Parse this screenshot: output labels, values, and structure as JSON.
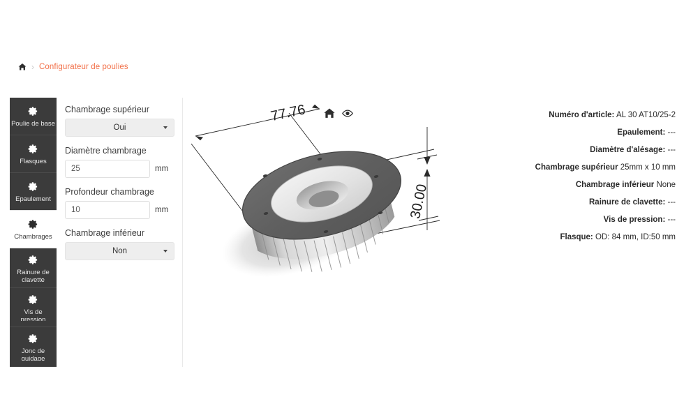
{
  "breadcrumb": {
    "home_icon": "home-icon",
    "separator": "›",
    "link": "Configurateur de poulies"
  },
  "sidebar": {
    "items": [
      {
        "label": "Poulie de base",
        "icon": "gear-icon",
        "active": false
      },
      {
        "label": "Flasques",
        "icon": "gear-icon",
        "active": false
      },
      {
        "label": "Epaulement",
        "icon": "gear-icon",
        "active": false
      },
      {
        "label": "Chambrages",
        "icon": "gear-icon",
        "active": true
      },
      {
        "label": "Rainure de clavette",
        "icon": "gear-icon",
        "active": false
      },
      {
        "label": "Vis de pression",
        "icon": "gear-icon",
        "active": false
      },
      {
        "label": "Jonc de guidage",
        "icon": "gear-icon",
        "active": false
      }
    ]
  },
  "form": {
    "chambrage_superieur": {
      "label": "Chambrage supérieur",
      "value": "Oui",
      "options": [
        "Oui",
        "Non"
      ]
    },
    "diametre_chambrage": {
      "label": "Diamètre chambrage",
      "value": "25",
      "unit": "mm"
    },
    "profondeur_chambrage": {
      "label": "Profondeur chambrage",
      "value": "10",
      "unit": "mm"
    },
    "chambrage_inferieur": {
      "label": "Chambrage inférieur",
      "value": "Non",
      "options": [
        "Oui",
        "Non"
      ]
    }
  },
  "viewer": {
    "toolbar": {
      "home_icon": "home-icon",
      "view_icon": "eye-icon"
    },
    "dimensions": {
      "diameter": "77.76",
      "height": "30.00"
    }
  },
  "info": {
    "lines": [
      {
        "label": "Numéro d'article:",
        "value": "AL 30 AT10/25-2"
      },
      {
        "label": "Epaulement:",
        "value": "---"
      },
      {
        "label": "Diamètre d'alésage:",
        "value": "---"
      },
      {
        "label": "Chambrage supérieur",
        "value": "25mm x 10 mm"
      },
      {
        "label": "Chambrage inférieur",
        "value": "None"
      },
      {
        "label": "Rainure de clavette:",
        "value": "---"
      },
      {
        "label": "Vis de pression:",
        "value": "---"
      },
      {
        "label": "Flasque:",
        "value": "OD: 84 mm, ID:50 mm"
      }
    ]
  },
  "colors": {
    "accent": "#f2714a",
    "sidebar_bg": "#3b3b3b",
    "select_bg": "#eeeeee",
    "text": "#2b2b2b"
  }
}
